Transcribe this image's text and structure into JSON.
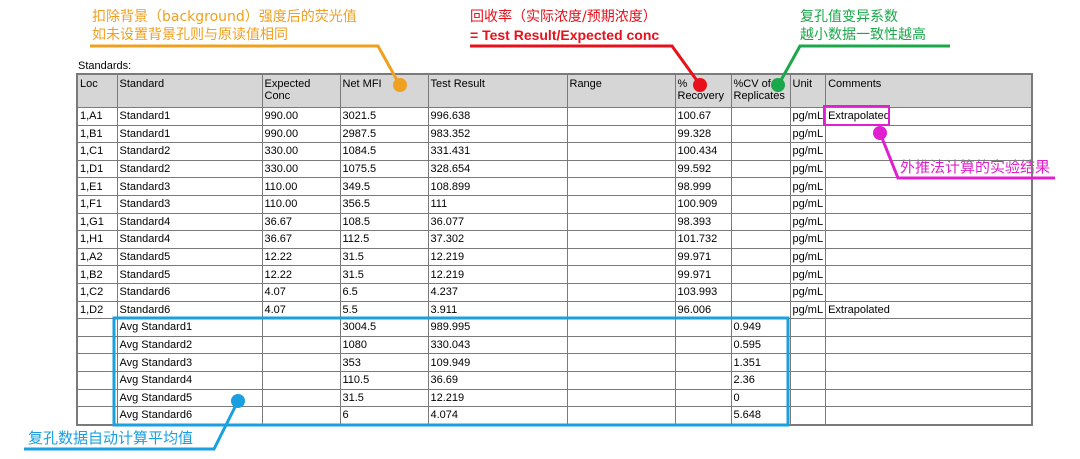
{
  "annotations": {
    "background_note_line1": "扣除背景（background）强度后的荧光值",
    "background_note_line2": "如未设置背景孔则与原读值相同",
    "recovery_note_line1": "回收率（实际浓度/预期浓度）",
    "recovery_note_line2": "=  Test Result/Expected conc",
    "cv_note_line1": "复孔值变异系数",
    "cv_note_line2": "越小数据一致性越高",
    "extrapolated_note": "外推法计算的实验结果",
    "avg_note": "复孔数据自动计算平均值"
  },
  "section_label": "Standards:",
  "table": {
    "headers": [
      [
        "Loc"
      ],
      [
        "Standard"
      ],
      [
        "Expected",
        "Conc"
      ],
      [
        "Net MFI"
      ],
      [
        "Test Result"
      ],
      [
        "Range"
      ],
      [
        "%",
        "Recovery"
      ],
      [
        "%CV of",
        "Replicates"
      ],
      [
        "Unit"
      ],
      [
        "Comments"
      ]
    ],
    "rows": [
      [
        "1,A1",
        "Standard1",
        "990.00",
        "3021.5",
        "996.638",
        "",
        "100.67",
        "",
        "pg/mL",
        "Extrapolated"
      ],
      [
        "1,B1",
        "Standard1",
        "990.00",
        "2987.5",
        "983.352",
        "",
        "99.328",
        "",
        "pg/mL",
        ""
      ],
      [
        "1,C1",
        "Standard2",
        "330.00",
        "1084.5",
        "331.431",
        "",
        "100.434",
        "",
        "pg/mL",
        ""
      ],
      [
        "1,D1",
        "Standard2",
        "330.00",
        "1075.5",
        "328.654",
        "",
        "99.592",
        "",
        "pg/mL",
        ""
      ],
      [
        "1,E1",
        "Standard3",
        "110.00",
        "349.5",
        "108.899",
        "",
        "98.999",
        "",
        "pg/mL",
        ""
      ],
      [
        "1,F1",
        "Standard3",
        "110.00",
        "356.5",
        "111",
        "",
        "100.909",
        "",
        "pg/mL",
        ""
      ],
      [
        "1,G1",
        "Standard4",
        "36.67",
        "108.5",
        "36.077",
        "",
        "98.393",
        "",
        "pg/mL",
        ""
      ],
      [
        "1,H1",
        "Standard4",
        "36.67",
        "112.5",
        "37.302",
        "",
        "101.732",
        "",
        "pg/mL",
        ""
      ],
      [
        "1,A2",
        "Standard5",
        "12.22",
        "31.5",
        "12.219",
        "",
        "99.971",
        "",
        "pg/mL",
        ""
      ],
      [
        "1,B2",
        "Standard5",
        "12.22",
        "31.5",
        "12.219",
        "",
        "99.971",
        "",
        "pg/mL",
        ""
      ],
      [
        "1,C2",
        "Standard6",
        "4.07",
        "6.5",
        "4.237",
        "",
        "103.993",
        "",
        "pg/mL",
        ""
      ],
      [
        "1,D2",
        "Standard6",
        "4.07",
        "5.5",
        "3.911",
        "",
        "96.006",
        "",
        "pg/mL",
        "Extrapolated"
      ],
      [
        "",
        "Avg Standard1",
        "",
        "3004.5",
        "989.995",
        "",
        "",
        "0.949",
        "",
        ""
      ],
      [
        "",
        "Avg Standard2",
        "",
        "1080",
        "330.043",
        "",
        "",
        "0.595",
        "",
        ""
      ],
      [
        "",
        "Avg Standard3",
        "",
        "353",
        "109.949",
        "",
        "",
        "1.351",
        "",
        ""
      ],
      [
        "",
        "Avg Standard4",
        "",
        "110.5",
        "36.69",
        "",
        "",
        "2.36",
        "",
        ""
      ],
      [
        "",
        "Avg Standard5",
        "",
        "31.5",
        "12.219",
        "",
        "",
        "0",
        "",
        ""
      ],
      [
        "",
        "Avg Standard6",
        "",
        "6",
        "4.074",
        "",
        "",
        "5.648",
        "",
        ""
      ]
    ]
  },
  "colors": {
    "orange": "#f0a020",
    "red": "#e8101a",
    "green": "#1aa84a",
    "magenta": "#e020d0",
    "blue": "#1aa0e0",
    "header_bg": "#d6d6d6"
  }
}
